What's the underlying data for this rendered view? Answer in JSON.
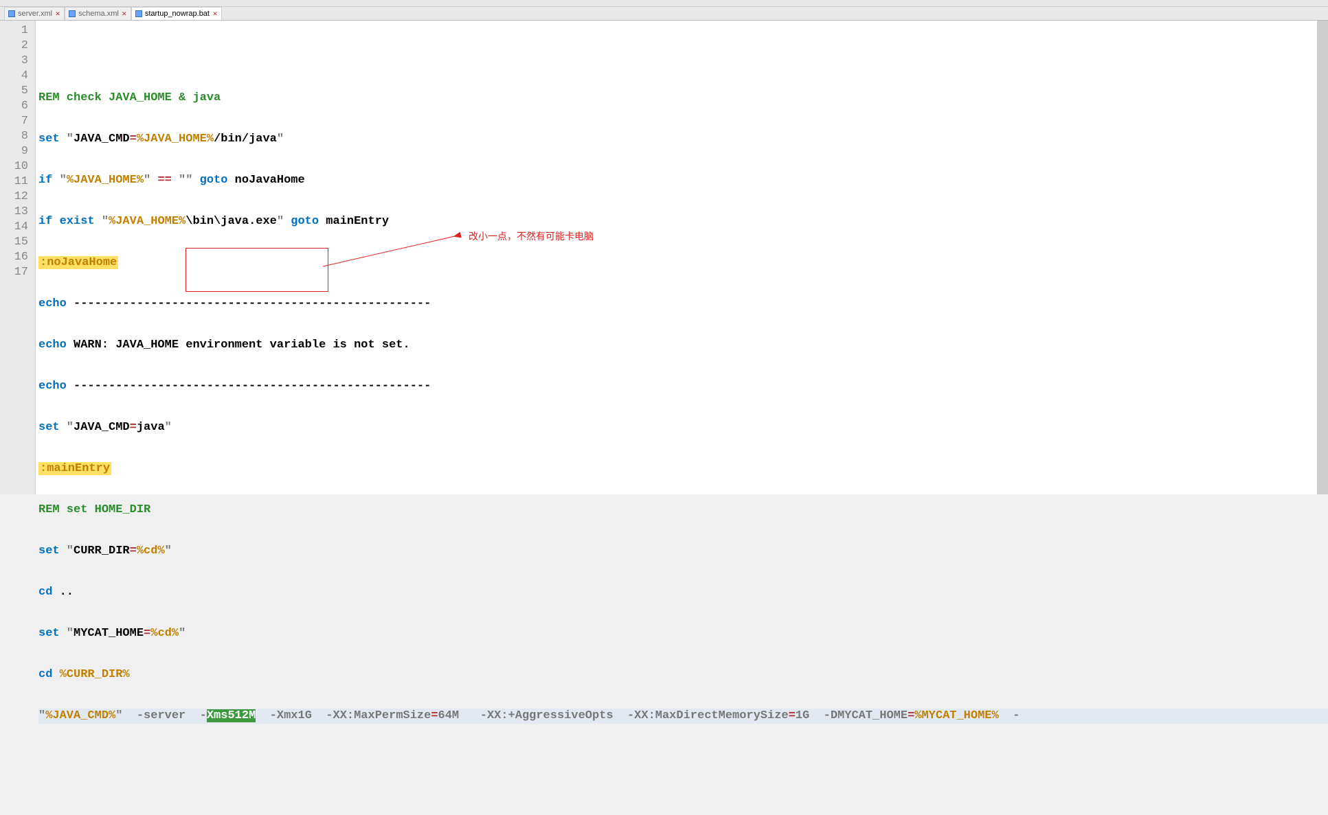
{
  "tabs": [
    {
      "label": "server.xml",
      "active": false
    },
    {
      "label": "schema.xml",
      "active": false
    },
    {
      "label": "startup_nowrap.bat",
      "active": true
    }
  ],
  "gutter": [
    "1",
    "2",
    "3",
    "4",
    "5",
    "6",
    "7",
    "8",
    "9",
    "10",
    "11",
    "12",
    "13",
    "14",
    "15",
    "16",
    "17"
  ],
  "code": {
    "l2": {
      "rem": "REM",
      "txt": " check JAVA_HOME & java"
    },
    "l3": {
      "kw": "set",
      "q1": " \"",
      "t1": "JAVA_CMD",
      "eq": "=",
      "v": "%JAVA_HOME%",
      "t2": "/bin/java",
      "q2": "\""
    },
    "l4": {
      "kw": "if",
      "q1": " \"",
      "v": "%JAVA_HOME%",
      "q2": "\" ",
      "op": "==",
      "q3": " \"\" ",
      "kw2": "goto",
      "t": " noJavaHome"
    },
    "l5": {
      "kw": "if",
      "kw2": " exist",
      "q1": " \"",
      "v": "%JAVA_HOME%",
      "t": "\\bin\\java.exe",
      "q2": "\" ",
      "kw3": "goto",
      "t2": " mainEntry"
    },
    "l6": {
      "lbl": ":noJavaHome"
    },
    "l7": {
      "kw": "echo",
      "t": " ---------------------------------------------------"
    },
    "l8": {
      "kw": "echo",
      "t": " WARN: JAVA_HOME environment variable is not set."
    },
    "l9": {
      "kw": "echo",
      "t": " ---------------------------------------------------"
    },
    "l10": {
      "kw": "set",
      "q1": " \"",
      "t1": "JAVA_CMD",
      "eq": "=",
      "t2": "java",
      "q2": "\""
    },
    "l11": {
      "lbl": ":mainEntry"
    },
    "l12": {
      "rem": "REM",
      "txt": " set HOME_DIR"
    },
    "l13": {
      "kw": "set",
      "q1": " \"",
      "t1": "CURR_DIR",
      "eq": "=",
      "v": "%cd%",
      "q2": "\""
    },
    "l14": {
      "kw": "cd",
      "t": " .."
    },
    "l15": {
      "kw": "set",
      "q1": " \"",
      "t1": "MYCAT_HOME",
      "eq": "=",
      "v": "%cd%",
      "q2": "\""
    },
    "l16": {
      "kw": "cd",
      "v": " %CURR_DIR%"
    },
    "l17": {
      "q1": "\"",
      "v1": "%JAVA_CMD%",
      "q2": "\"",
      "a1": "  -server  -",
      "sel": "Xms512M",
      "a2": "  -Xmx1G  -XX:MaxPermSize",
      "eq1": "=",
      "a3": "64M   -XX:+AggressiveOpts  -XX:MaxDirectMemorySize",
      "eq2": "=",
      "a4": "1G  -DMYCAT_HOME",
      "eq3": "=",
      "v2": "%MYCAT_HOME%",
      "a5": "  -"
    }
  },
  "annotation": {
    "text": "改小一点，不然有可能卡电脑"
  }
}
